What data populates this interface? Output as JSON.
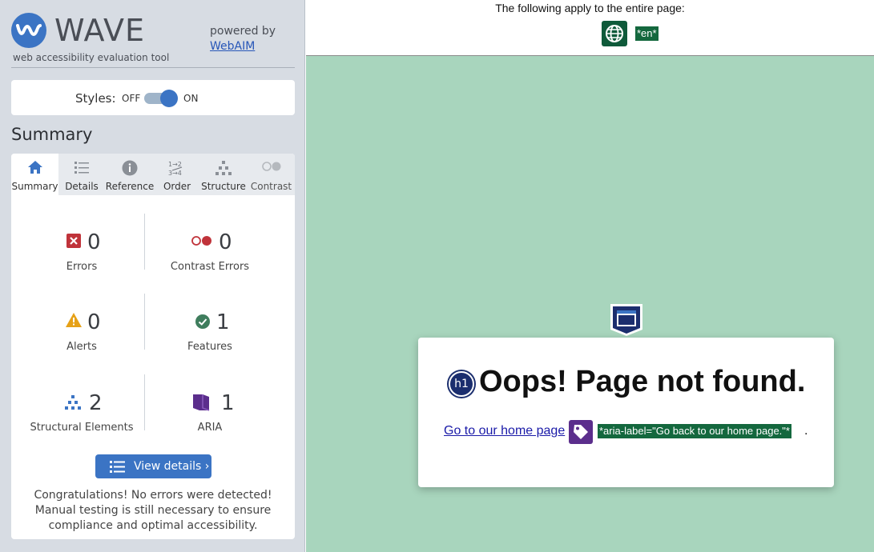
{
  "sidebar": {
    "logo": {
      "word": "WAVE",
      "subtitle": "web accessibility evaluation tool",
      "icon": "wave-logo-icon"
    },
    "powered_by": "powered by",
    "webaim_link": "WebAIM",
    "styles": {
      "label": "Styles:",
      "off": "OFF",
      "on": "ON",
      "state": "on"
    },
    "summary_title": "Summary",
    "tabs": [
      {
        "label": "Summary",
        "icon": "home-icon",
        "active": true
      },
      {
        "label": "Details",
        "icon": "list-icon",
        "active": false
      },
      {
        "label": "Reference",
        "icon": "info-icon",
        "active": false
      },
      {
        "label": "Order",
        "icon": "order-icon",
        "active": false
      },
      {
        "label": "Structure",
        "icon": "structure-icon",
        "active": false
      },
      {
        "label": "Contrast",
        "icon": "contrast-icon",
        "active": false
      }
    ],
    "stats": {
      "errors": {
        "count": "0",
        "label": "Errors",
        "color": "#c0333a"
      },
      "contrast_errors": {
        "count": "0",
        "label": "Contrast Errors",
        "color": "#c0333a"
      },
      "alerts": {
        "count": "0",
        "label": "Alerts",
        "color": "#e6a117"
      },
      "features": {
        "count": "1",
        "label": "Features",
        "color": "#3f7d5d"
      },
      "structural": {
        "count": "2",
        "label": "Structural Elements",
        "color": "#3b74c4"
      },
      "aria": {
        "count": "1",
        "label": "ARIA",
        "color": "#5b2e8c"
      }
    },
    "view_details": "View details ›",
    "congrats": "Congratulations! No errors were detected! Manual testing is still necessary to ensure compliance and optimal accessibility."
  },
  "main": {
    "apply_text": "The following apply to the entire page:",
    "lang_tag": "*en*",
    "heading": "Oops! Page not found.",
    "h1_badge": "h1",
    "home_link": "Go to our home page",
    "aria_label": "*aria-label=\"Go back to our home page.\"*",
    "trailing": ".",
    "background": "#a8d5bd"
  }
}
